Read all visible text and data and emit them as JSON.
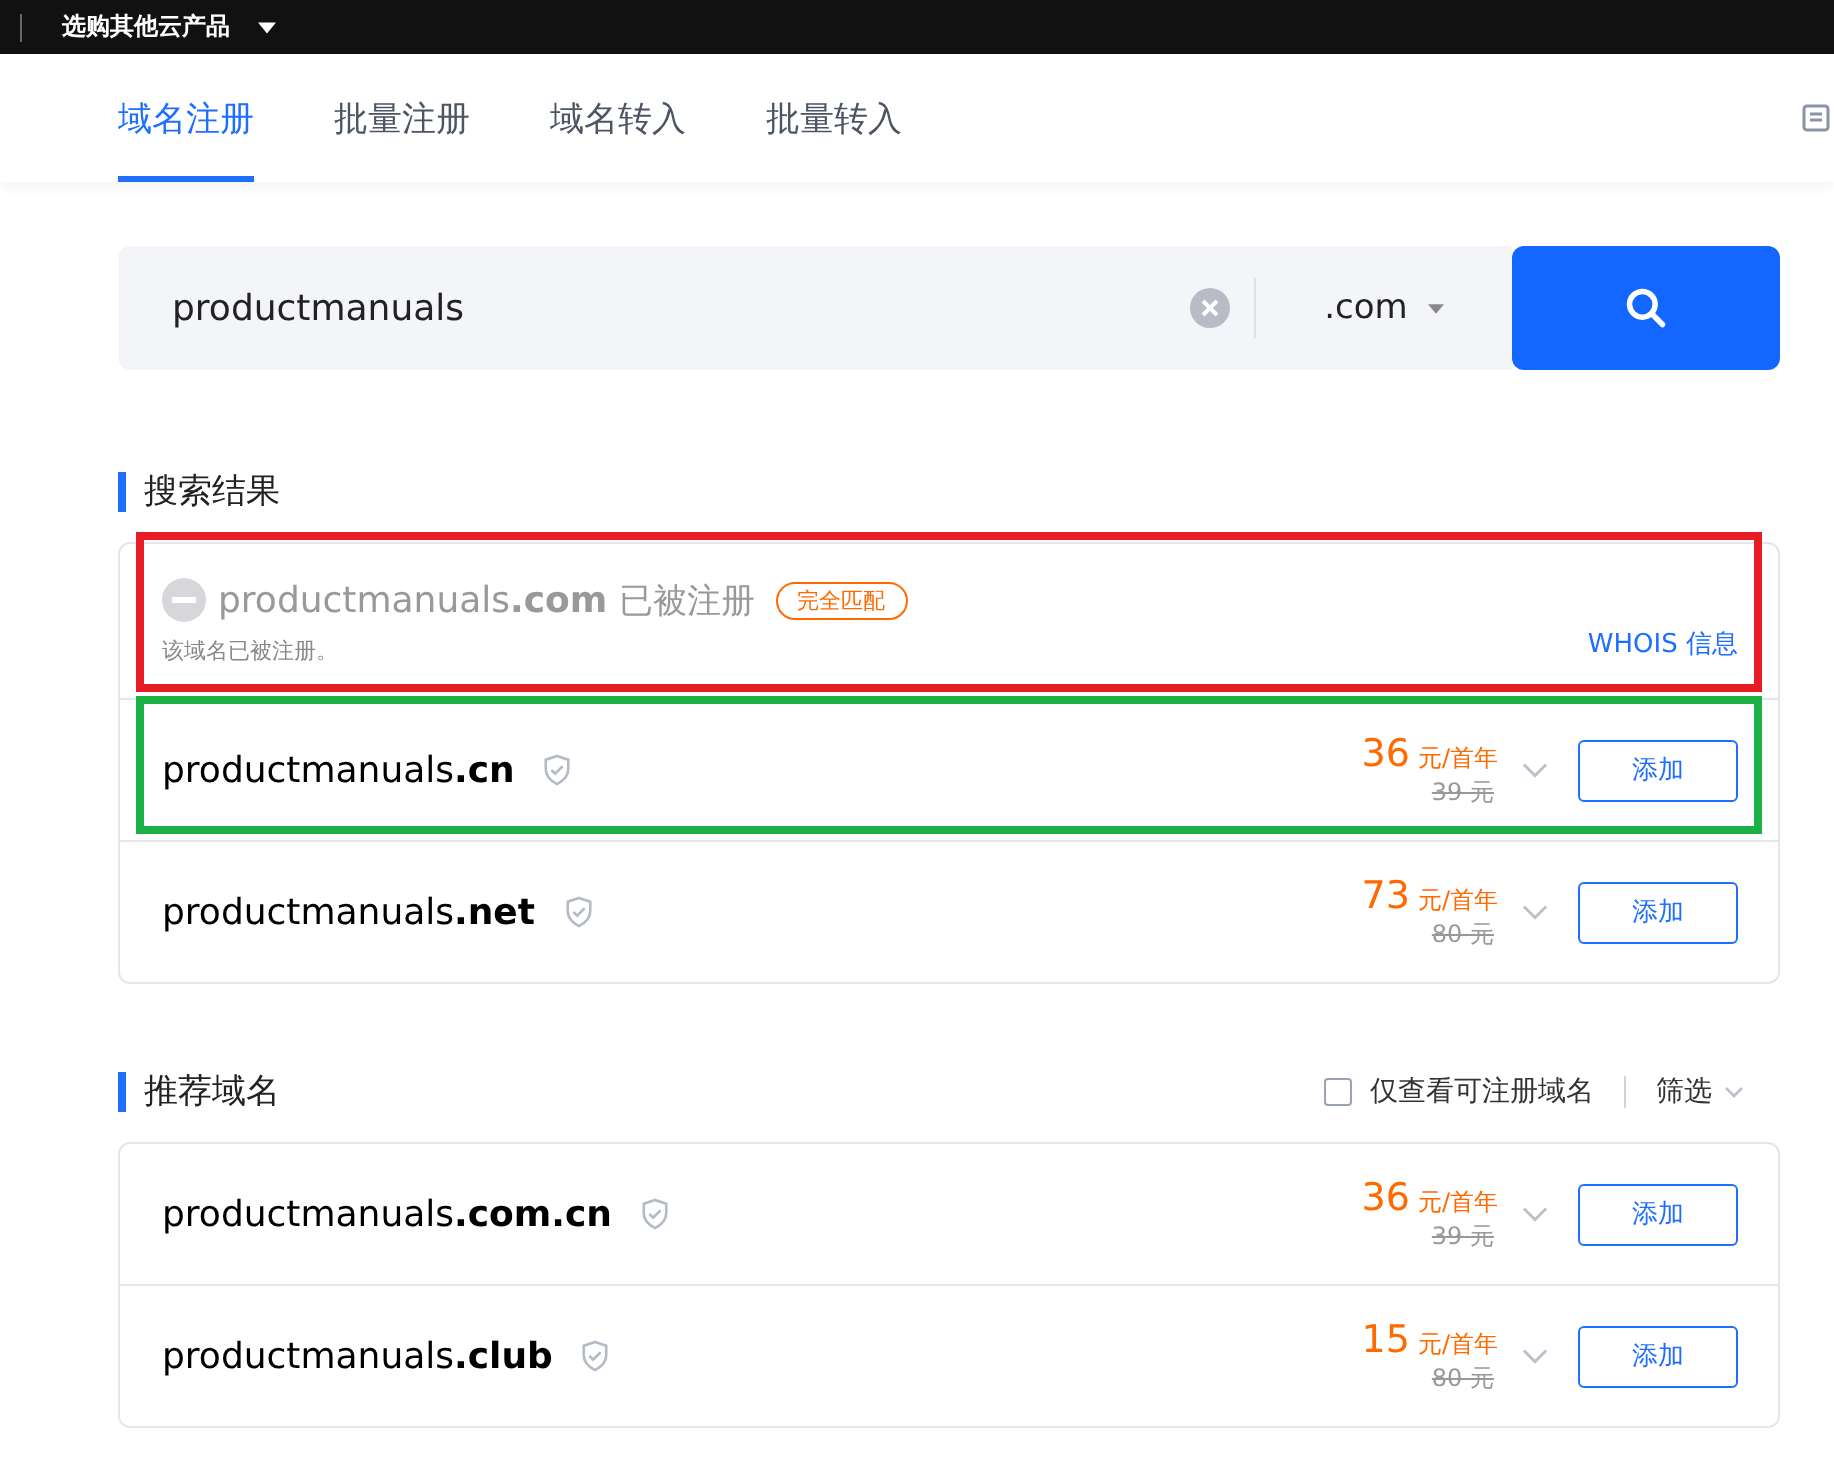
{
  "top_bar": {
    "menu": "选购其他云产品"
  },
  "tabs": [
    {
      "label": "域名注册",
      "selected": true
    },
    {
      "label": "批量注册",
      "selected": false
    },
    {
      "label": "域名转入",
      "selected": false
    },
    {
      "label": "批量转入",
      "selected": false
    }
  ],
  "search": {
    "value": "productmanuals",
    "suffix": ".com"
  },
  "results": {
    "title": "搜索结果",
    "rows": [
      {
        "kind": "taken",
        "name": "productmanuals",
        "tld": ".com",
        "status": "已被注册",
        "badge": "完全匹配",
        "note": "该域名已被注册。",
        "link": "WHOIS 信息",
        "color": "#e81c24"
      },
      {
        "kind": "available",
        "name": "productmanuals",
        "tld": ".cn",
        "price": "36",
        "unit": "元/首年",
        "old_price": "39 元",
        "button": "添加",
        "color": "#1db045"
      },
      {
        "kind": "available",
        "name": "productmanuals",
        "tld": ".net",
        "price": "73",
        "unit": "元/首年",
        "old_price": "80 元",
        "button": "添加"
      }
    ]
  },
  "recommended": {
    "title": "推荐域名",
    "filter_checkbox": {
      "label": "仅查看可注册域名",
      "checked": false
    },
    "filter": "筛选",
    "rows": [
      {
        "kind": "available",
        "name": "productmanuals",
        "tld": ".com.cn",
        "price": "36",
        "unit": "元/首年",
        "old_price": "39 元",
        "button": "添加"
      },
      {
        "kind": "available",
        "name": "productmanuals",
        "tld": ".club",
        "price": "15",
        "unit": "元/首年",
        "old_price": "80 元",
        "button": "添加"
      }
    ]
  }
}
